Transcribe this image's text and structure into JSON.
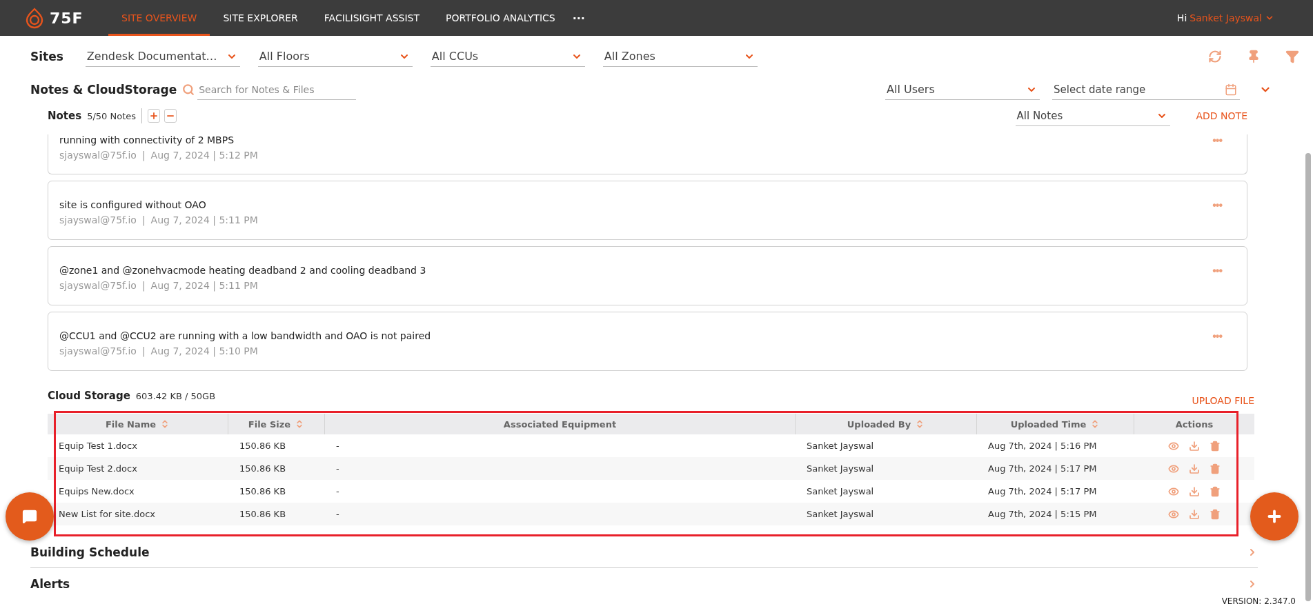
{
  "nav": {
    "logo_text": "75F",
    "tabs": [
      {
        "label": "SITE OVERVIEW",
        "selected": true
      },
      {
        "label": "SITE EXPLORER",
        "selected": false
      },
      {
        "label": "FACILISIGHT ASSIST",
        "selected": false
      },
      {
        "label": "PORTFOLIO ANALYTICS",
        "selected": false
      }
    ],
    "more": "···",
    "greeting": "Hi",
    "user_name": "Sanket Jayswal"
  },
  "filters": {
    "label": "Sites",
    "dropdowns": [
      "Zendesk Documentat…",
      "All Floors",
      "All CCUs",
      "All Zones"
    ]
  },
  "notes_storage": {
    "title": "Notes & CloudStorage",
    "search_placeholder": "Search for Notes & Files",
    "users_dropdown": "All Users",
    "date_placeholder": "Select date range"
  },
  "notes": {
    "title": "Notes",
    "count": "5/50 Notes",
    "filter": "All Notes",
    "add_label": "ADD NOTE",
    "items": [
      {
        "text": "running with connectivity of 2 MBPS",
        "author": "sjayswal@75f.io",
        "time": "Aug 7, 2024 | 5:12 PM",
        "separator": "|",
        "more": "•••",
        "clipped": true
      },
      {
        "text": "site is configured without OAO",
        "author": "sjayswal@75f.io",
        "time": "Aug 7, 2024 | 5:11 PM",
        "separator": "|",
        "more": "•••",
        "clipped": false
      },
      {
        "text": "@zone1 and @zonehvacmode heating deadband 2 and cooling deadband 3",
        "author": "sjayswal@75f.io",
        "time": "Aug 7, 2024 | 5:11 PM",
        "separator": "|",
        "more": "•••",
        "clipped": false
      },
      {
        "text": "@CCU1 and @CCU2 are running with a low bandwidth and OAO is not paired",
        "author": "sjayswal@75f.io",
        "time": "Aug 7, 2024 | 5:10 PM",
        "separator": "|",
        "more": "•••",
        "clipped": false
      }
    ]
  },
  "cloud_storage": {
    "title": "Cloud Storage",
    "usage": "603.42 KB / 50GB",
    "upload_label": "UPLOAD FILE",
    "columns": [
      {
        "label": "File Name",
        "sortable": true
      },
      {
        "label": "File Size",
        "sortable": true
      },
      {
        "label": "Associated Equipment",
        "sortable": false
      },
      {
        "label": "Uploaded By",
        "sortable": true
      },
      {
        "label": "Uploaded Time",
        "sortable": true
      },
      {
        "label": "Actions",
        "sortable": false
      }
    ],
    "rows": [
      {
        "file_name": "Equip Test 1.docx",
        "file_size": "150.86 KB",
        "equipment": "-",
        "uploaded_by": "Sanket Jayswal",
        "uploaded_time": "Aug 7th, 2024 | 5:16 PM"
      },
      {
        "file_name": "Equip Test 2.docx",
        "file_size": "150.86 KB",
        "equipment": "-",
        "uploaded_by": "Sanket Jayswal",
        "uploaded_time": "Aug 7th, 2024 | 5:17 PM"
      },
      {
        "file_name": "Equips New.docx",
        "file_size": "150.86 KB",
        "equipment": "-",
        "uploaded_by": "Sanket Jayswal",
        "uploaded_time": "Aug 7th, 2024 | 5:17 PM"
      },
      {
        "file_name": "New List for site.docx",
        "file_size": "150.86 KB",
        "equipment": "-",
        "uploaded_by": "Sanket Jayswal",
        "uploaded_time": "Aug 7th, 2024 | 5:15 PM"
      }
    ]
  },
  "sections": [
    {
      "title": "Building Schedule"
    },
    {
      "title": "Alerts"
    }
  ],
  "version": "VERSION: 2.347.0"
}
